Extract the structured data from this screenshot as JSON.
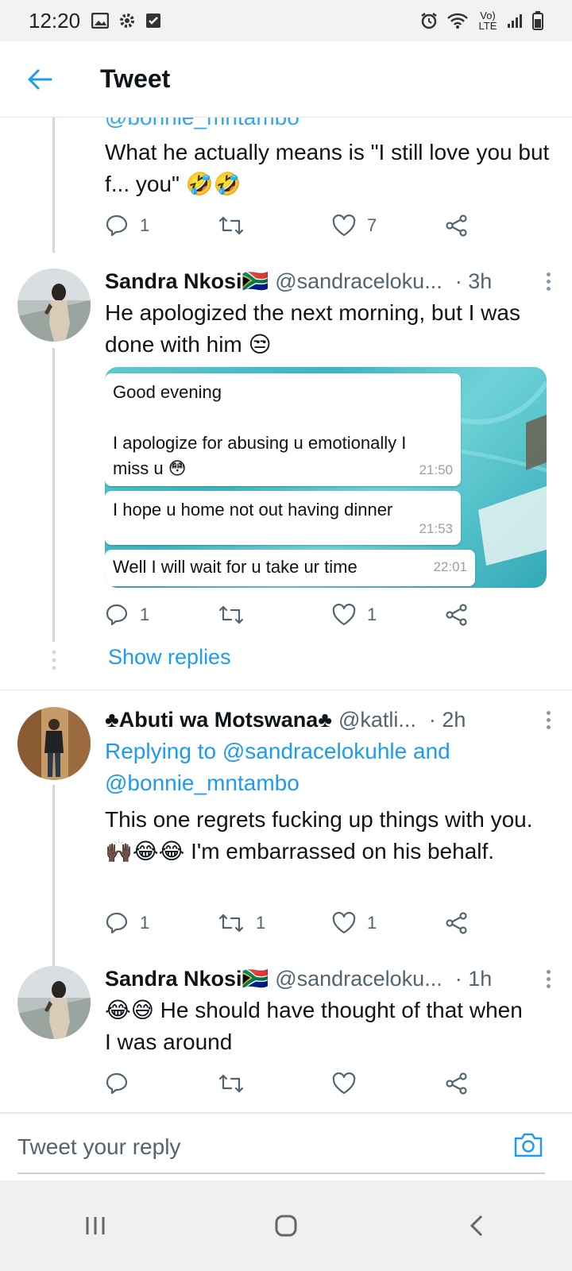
{
  "status_bar": {
    "time": "12:20",
    "network": "Vo) LTE"
  },
  "header": {
    "title": "Tweet"
  },
  "thread": {
    "partial_tweet": {
      "mention_cut": "@bonnie_mntambo",
      "text": "What he actually means is \"I still love you but f... you\" 🤣🤣",
      "reply_count": "1",
      "retweet_count": "",
      "like_count": "7"
    },
    "tweet2": {
      "name": "Sandra Nkosi🇿🇦",
      "handle": "@sandraceloku...",
      "time": "· 3h",
      "text": "He apologized the next morning, but I was done with him 😒",
      "reply_count": "1",
      "retweet_count": "",
      "like_count": "1",
      "media": {
        "bubbles": [
          {
            "text_line1": "Good evening",
            "text_line2": "I apologize for abusing u emotionally I",
            "text_line3": "miss u 😳",
            "time": "21:50"
          },
          {
            "text_line1": "I hope u home not out having dinner",
            "time": "21:53"
          },
          {
            "text_line1": "Well I will wait for u take ur time",
            "time": "22:01"
          }
        ]
      }
    },
    "show_replies": "Show replies",
    "tweet3": {
      "name": "♣Abuti wa Motswana♣",
      "handle": "@katli...",
      "time": "· 2h",
      "replying_prefix": "Replying to ",
      "replying_to_1": "@sandracelokuhle",
      "replying_and": " and",
      "replying_to_2": "@bonnie_mntambo",
      "text": "This one regrets fucking up things with you.🙌🏿😂😂 I'm embarrassed on his behalf.",
      "reply_count": "1",
      "retweet_count": "1",
      "like_count": "1"
    },
    "tweet4": {
      "name": "Sandra Nkosi🇿🇦",
      "handle": "@sandraceloku...",
      "time": "· 1h",
      "text": "😂😅 He should have thought of that when I was around",
      "reply_count": "",
      "retweet_count": "",
      "like_count": ""
    }
  },
  "composer": {
    "placeholder": "Tweet your reply"
  },
  "colors": {
    "accent": "#1d9bf0",
    "text": "#0f1419",
    "muted": "#536471"
  }
}
